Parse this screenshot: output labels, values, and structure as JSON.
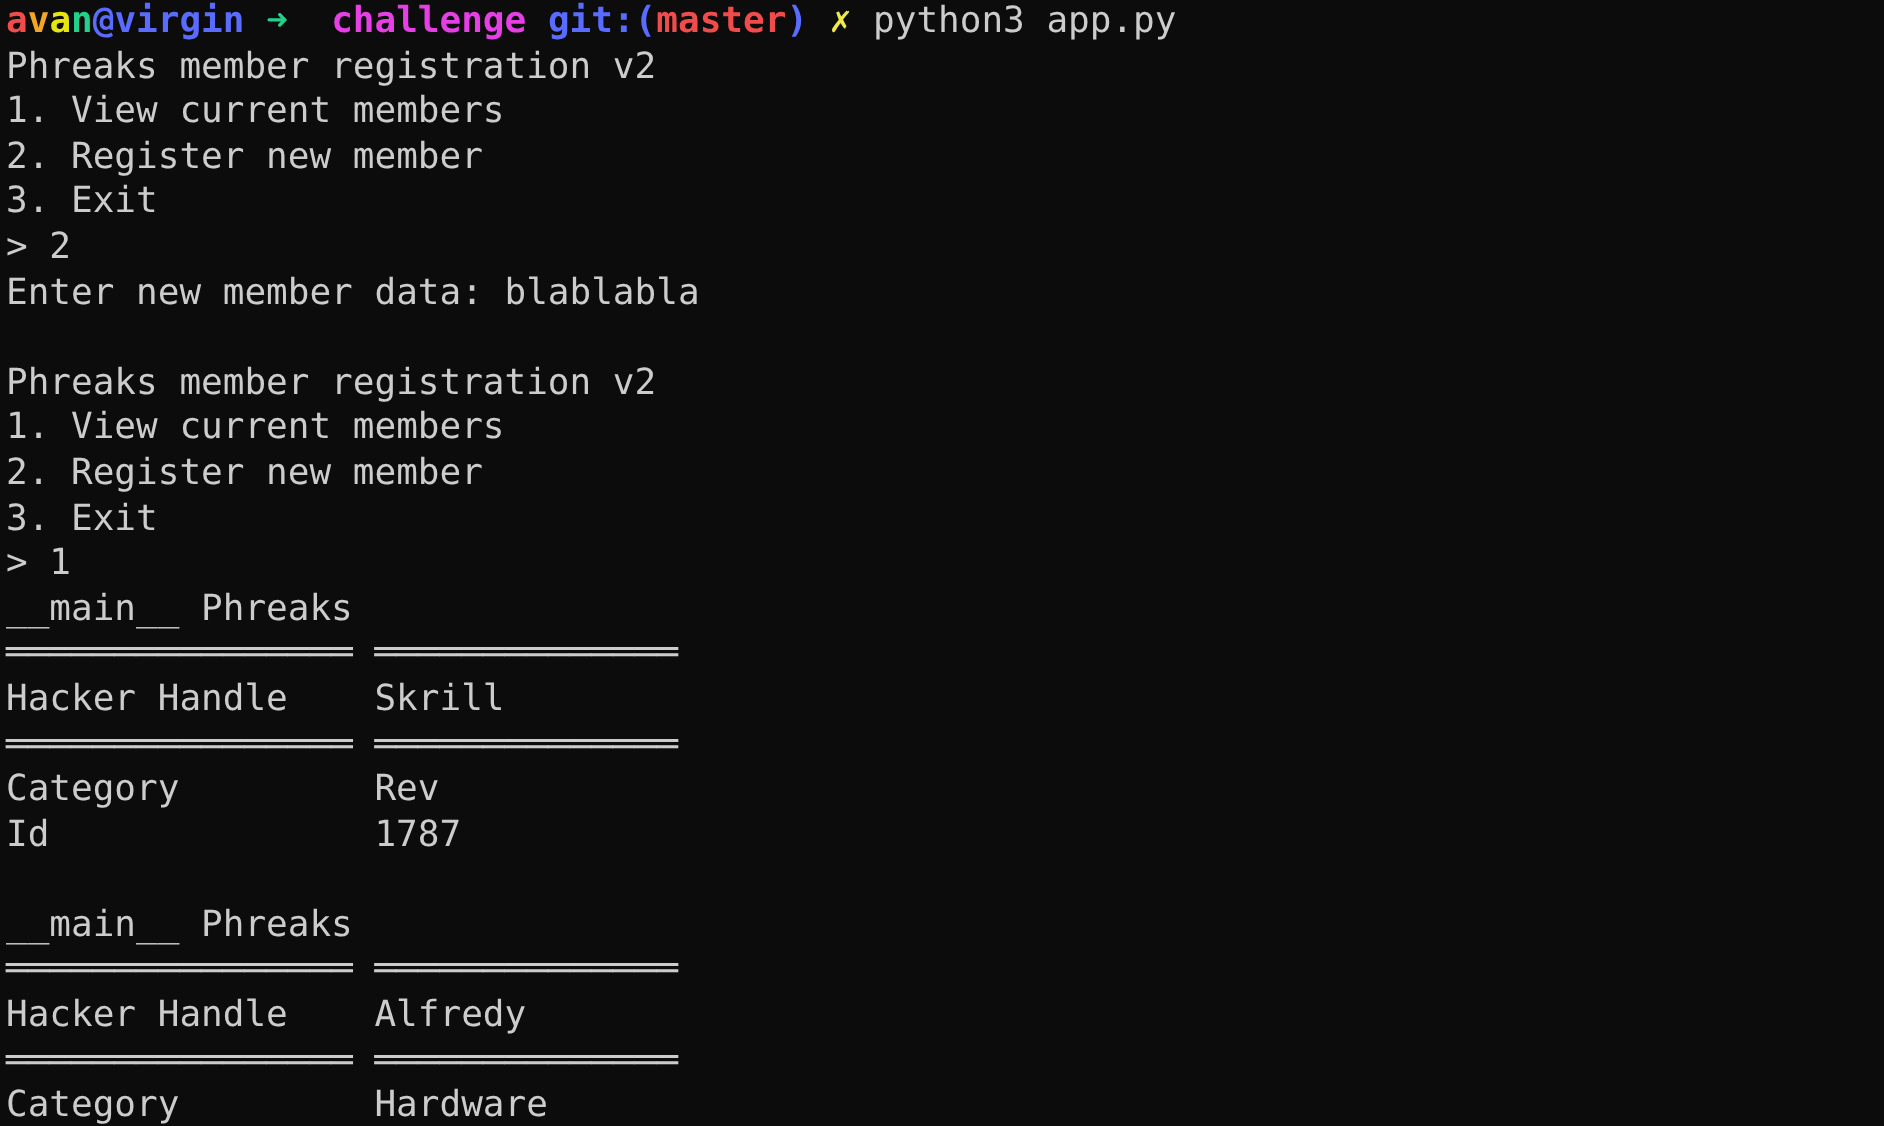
{
  "prompt": {
    "segments": [
      {
        "kind": "user",
        "text": "avan"
      },
      {
        "kind": "host",
        "text": "@virgin"
      },
      {
        "kind": "arrow",
        "text": "➜"
      },
      {
        "kind": "dir",
        "text": "challenge"
      },
      {
        "kind": "git-open",
        "text": "git:("
      },
      {
        "kind": "branch",
        "text": "master"
      },
      {
        "kind": "git-close",
        "text": ")"
      },
      {
        "kind": "dirty",
        "text": "✗"
      },
      {
        "kind": "command",
        "text": "python3 app.py"
      }
    ]
  },
  "lines": [
    {
      "kind": "text",
      "text": "Phreaks member registration v2"
    },
    {
      "kind": "text",
      "text": "1. View current members"
    },
    {
      "kind": "text",
      "text": "2. Register new member"
    },
    {
      "kind": "text",
      "text": "3. Exit"
    },
    {
      "kind": "text",
      "text": "> 2"
    },
    {
      "kind": "text",
      "text": "Enter new member data: blablabla"
    },
    {
      "kind": "blank"
    },
    {
      "kind": "text",
      "text": "Phreaks member registration v2"
    },
    {
      "kind": "text",
      "text": "1. View current members"
    },
    {
      "kind": "text",
      "text": "2. Register new member"
    },
    {
      "kind": "text",
      "text": "3. Exit"
    },
    {
      "kind": "text",
      "text": "> 1"
    },
    {
      "kind": "text",
      "text": "__main__ Phreaks"
    },
    {
      "kind": "rule",
      "cells": [
        "════════════════",
        "══════════════"
      ]
    },
    {
      "kind": "row",
      "cells": [
        "Hacker Handle",
        "Skrill"
      ]
    },
    {
      "kind": "rule",
      "cells": [
        "════════════════",
        "══════════════"
      ]
    },
    {
      "kind": "row",
      "cells": [
        "Category",
        "Rev"
      ]
    },
    {
      "kind": "row",
      "cells": [
        "Id",
        "1787"
      ]
    },
    {
      "kind": "blank"
    },
    {
      "kind": "text",
      "text": "__main__ Phreaks"
    },
    {
      "kind": "rule",
      "cells": [
        "════════════════",
        "══════════════"
      ]
    },
    {
      "kind": "row",
      "cells": [
        "Hacker Handle",
        "Alfredy"
      ]
    },
    {
      "kind": "rule",
      "cells": [
        "════════════════",
        "══════════════"
      ]
    },
    {
      "kind": "row",
      "cells": [
        "Category",
        "Hardware"
      ]
    }
  ]
}
